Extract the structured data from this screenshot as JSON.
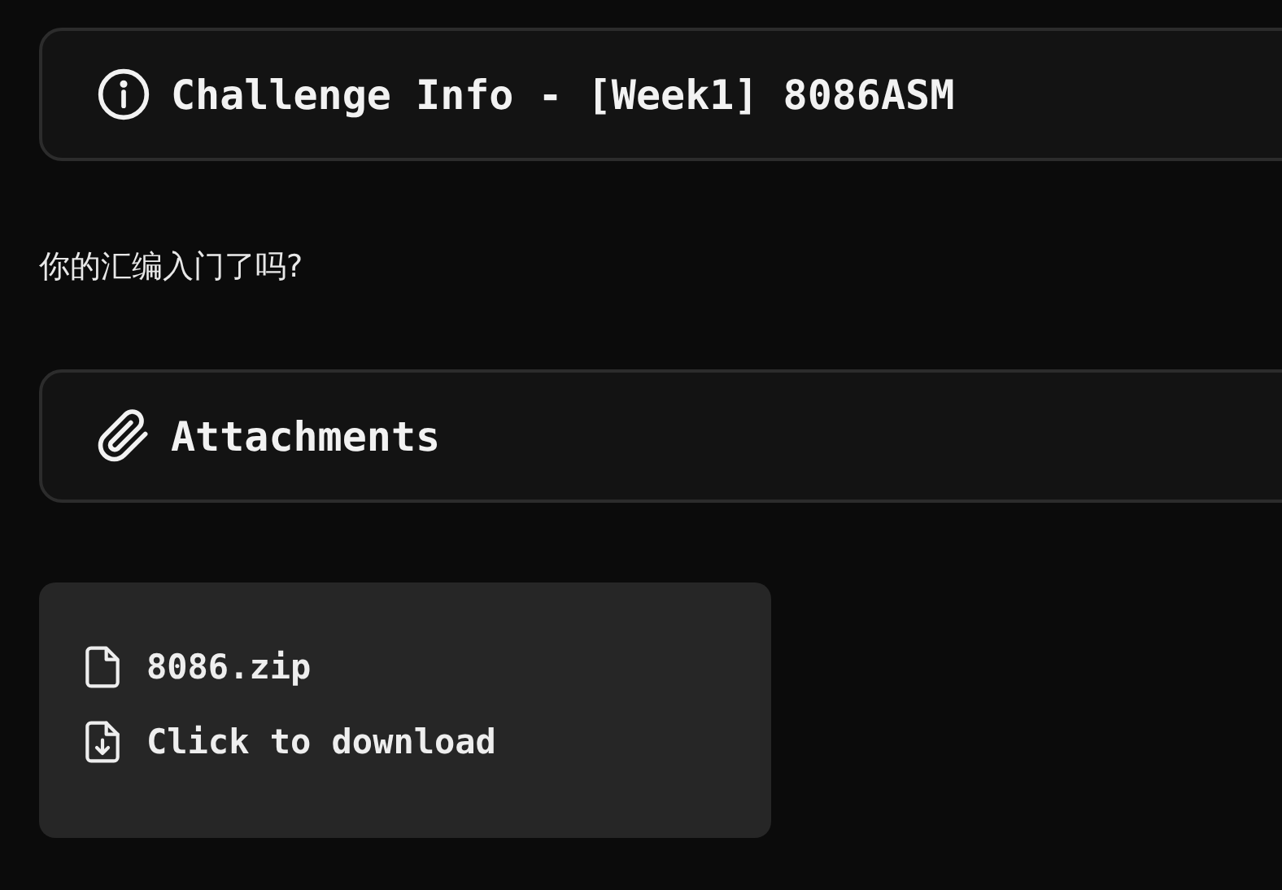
{
  "challenge_header": {
    "title": "Challenge Info - [Week1] 8086ASM"
  },
  "description": "你的汇编入门了吗?",
  "attachments_header": {
    "title": "Attachments"
  },
  "attachment": {
    "filename": "8086.zip",
    "download_label": "Click to download"
  }
}
